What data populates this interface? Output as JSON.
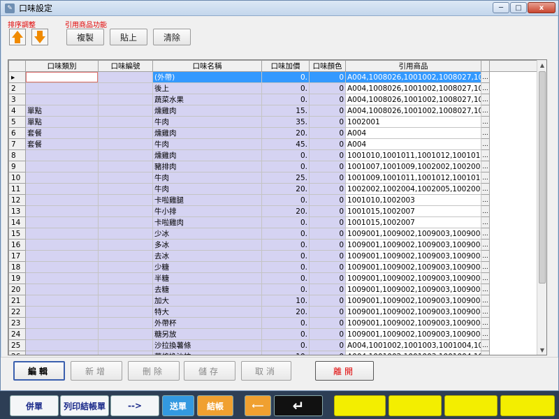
{
  "background_app": {
    "bottom_buttons": [
      "併單",
      "列印結帳單",
      "-->",
      "送單",
      "結帳"
    ]
  },
  "window": {
    "title": "口味設定",
    "controls": {
      "minimize": "─",
      "maximize": "□",
      "close": "x"
    }
  },
  "sort": {
    "label": "排序調整"
  },
  "cite": {
    "label": "引用商品功能",
    "copy": "複製",
    "paste": "貼上",
    "clear": "清除"
  },
  "grid": {
    "headers": [
      "口味類別",
      "口味編號",
      "口味名稱",
      "口味加價",
      "口味顏色",
      "引用商品"
    ],
    "rows": [
      [
        "▸",
        "",
        "",
        "(外帶)",
        "0.",
        "0",
        "A004,1008026,1001002,1008027,1001003,100…"
      ],
      [
        "2",
        "",
        "",
        "後上",
        "0.",
        "0",
        "A004,1008026,1001002,1008027,1001003,100…"
      ],
      [
        "3",
        "",
        "",
        "蔬菜水果",
        "0.",
        "0",
        "A004,1008026,1001002,1008027,1001003,100…"
      ],
      [
        "4",
        "單點",
        "",
        "燻雞肉",
        "15.",
        "0",
        "A004,1008026,1001002,1008027,1001003,100…"
      ],
      [
        "5",
        "單點",
        "",
        "牛肉",
        "35.",
        "0",
        "1002001"
      ],
      [
        "6",
        "套餐",
        "",
        "燻雞肉",
        "20.",
        "0",
        "A004"
      ],
      [
        "7",
        "套餐",
        "",
        "牛肉",
        "45.",
        "0",
        "A004"
      ],
      [
        "8",
        "",
        "",
        "燻雞肉",
        "0.",
        "0",
        "1001010,1001011,1001012,1001013,1001015,…"
      ],
      [
        "9",
        "",
        "",
        "豬排肉",
        "0.",
        "0",
        "1001007,1001009,1002002,1002003"
      ],
      [
        "10",
        "",
        "",
        "牛肉",
        "25.",
        "0",
        "1001009,1001011,1001012,1001013"
      ],
      [
        "11",
        "",
        "",
        "牛肉",
        "20.",
        "0",
        "1002002,1002004,1002005,1002006"
      ],
      [
        "12",
        "",
        "",
        "卡啦雞腿",
        "0.",
        "0",
        "1001010,1002003"
      ],
      [
        "13",
        "",
        "",
        "牛小排",
        "20.",
        "0",
        "1001015,1002007"
      ],
      [
        "14",
        "",
        "",
        "卡啦雞肉",
        "0.",
        "0",
        "1001015,1002007"
      ],
      [
        "15",
        "",
        "",
        "少冰",
        "0.",
        "0",
        "1009001,1009002,1009003,1009004,1009005,…"
      ],
      [
        "16",
        "",
        "",
        "多冰",
        "0.",
        "0",
        "1009001,1009002,1009003,1009004,1009005,…"
      ],
      [
        "17",
        "",
        "",
        "去冰",
        "0.",
        "0",
        "1009001,1009002,1009003,1009004,1009005,…"
      ],
      [
        "18",
        "",
        "",
        "少糖",
        "0.",
        "0",
        "1009001,1009002,1009003,1009004,1009005,…"
      ],
      [
        "19",
        "",
        "",
        "半糖",
        "0.",
        "0",
        "1009001,1009002,1009003,1009004,1009005,…"
      ],
      [
        "20",
        "",
        "",
        "去糖",
        "0.",
        "0",
        "1009001,1009002,1009003,1009004,1009005,…"
      ],
      [
        "21",
        "",
        "",
        "加大",
        "10.",
        "0",
        "1009001,1009002,1009003,1009004,1009005,…"
      ],
      [
        "22",
        "",
        "",
        "特大",
        "20.",
        "0",
        "1009001,1009002,1009003,1009004,1009005,…"
      ],
      [
        "23",
        "",
        "",
        "外帶杯",
        "0.",
        "0",
        "1009001,1009002,1009003,1009004,1009005,…"
      ],
      [
        "24",
        "",
        "",
        "糖另放",
        "0.",
        "0",
        "1009001,1009002,1009003,1009004,1009005,…"
      ],
      [
        "25",
        "",
        "",
        "沙拉換薯條",
        "0.",
        "0",
        "A004,1001002,1001003,1001004,1001005,100…"
      ],
      [
        "26",
        "",
        "",
        "薯條換沙拉",
        "10.",
        "0",
        "A004,1001002,1001003,1001004,1001005,100…"
      ]
    ],
    "ellipsis_label": "..."
  },
  "actions": {
    "edit": "編輯",
    "add": "新增",
    "delete": "刪除",
    "save": "儲存",
    "cancel": "取消",
    "leave": "離開"
  },
  "colors": {
    "row_highlight": "#3399ff",
    "editable_cell": "#d5d3f2",
    "sort_arrow": "#f08a00",
    "leave_text": "#e00000"
  }
}
